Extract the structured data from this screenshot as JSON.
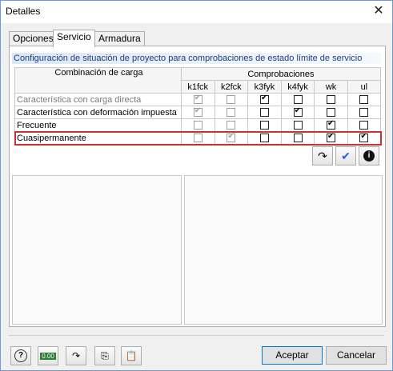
{
  "window": {
    "title": "Detalles",
    "close_glyph": "✕"
  },
  "tabs": [
    {
      "label": "Opciones"
    },
    {
      "label": "Servicio"
    },
    {
      "label": "Armadura"
    }
  ],
  "group": {
    "title": "Configuración de situación de proyecto para comprobaciones de estado límite de servicio",
    "col_name": "Combinación de carga",
    "col_checks": "Comprobaciones",
    "check_headers": [
      "k1fck",
      "k2fck",
      "k3fyk",
      "k4fyk",
      "wk",
      "ul"
    ],
    "rows": [
      {
        "name": "Característica con carga directa",
        "muted": true,
        "checks": [
          [
            true,
            true
          ],
          [
            false,
            true
          ],
          [
            true,
            false
          ],
          [
            false,
            false
          ],
          [
            false,
            false
          ],
          [
            false,
            false
          ]
        ]
      },
      {
        "name": "Característica con deformación impuesta",
        "muted": false,
        "checks": [
          [
            true,
            true
          ],
          [
            false,
            true
          ],
          [
            false,
            false
          ],
          [
            true,
            false
          ],
          [
            false,
            false
          ],
          [
            false,
            false
          ]
        ]
      },
      {
        "name": "Frecuente",
        "muted": false,
        "checks": [
          [
            false,
            true
          ],
          [
            false,
            true
          ],
          [
            false,
            false
          ],
          [
            false,
            false
          ],
          [
            true,
            false
          ],
          [
            false,
            false
          ]
        ]
      },
      {
        "name": "Cuasipermanente",
        "muted": false,
        "selected": true,
        "checks": [
          [
            false,
            true
          ],
          [
            true,
            true
          ],
          [
            false,
            false
          ],
          [
            false,
            false
          ],
          [
            true,
            false
          ],
          [
            true,
            false
          ]
        ]
      }
    ]
  },
  "icons": {
    "reset": "↷",
    "check": "✔",
    "info": "i"
  },
  "buttons": {
    "accept": "Aceptar",
    "cancel": "Cancelar"
  },
  "bottom_icons": [
    "help-icon",
    "units-icon",
    "reset-icon",
    "copy-icon",
    "paste-icon"
  ],
  "units_label": "0.00"
}
